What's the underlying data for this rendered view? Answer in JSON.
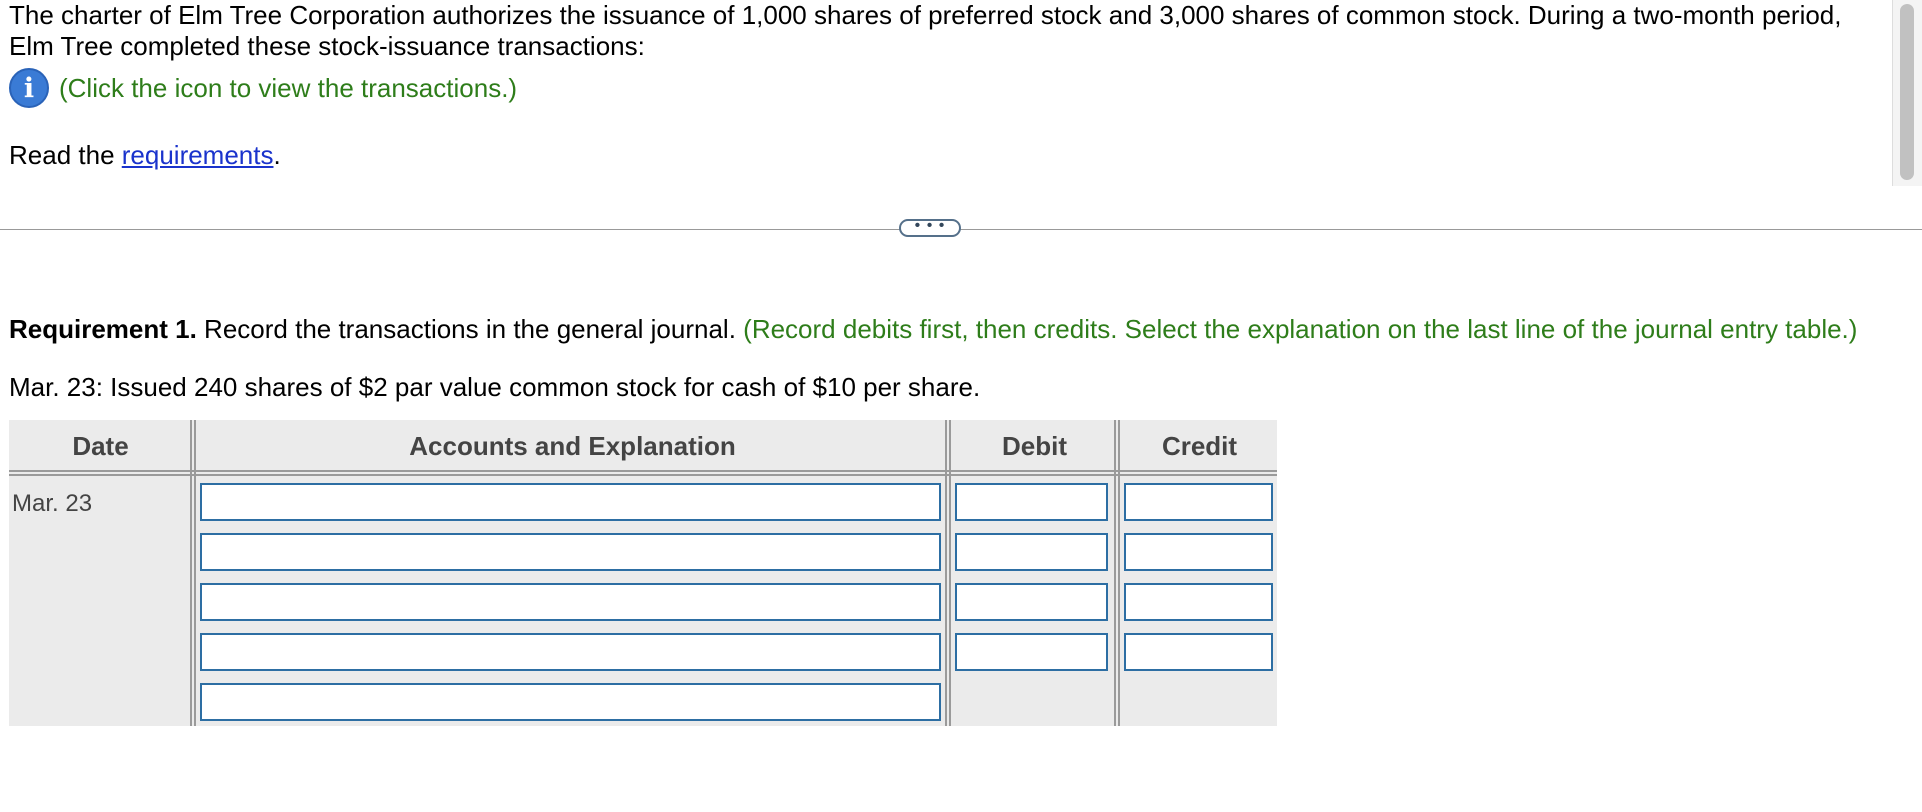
{
  "intro": {
    "text": "The charter of Elm Tree Corporation authorizes the issuance of 1,000 shares of preferred stock and 3,000 shares of common stock. During a two-month period, Elm Tree completed these stock-issuance transactions:",
    "info_icon_glyph": "i",
    "info_link": "(Click the icon to view the transactions.)"
  },
  "read": {
    "prefix": "Read the ",
    "link": "requirements",
    "suffix": "."
  },
  "expander": {
    "label": "• • •"
  },
  "requirement": {
    "bold": "Requirement 1.",
    "text": " Record the transactions in the general journal. ",
    "hint": "(Record debits first, then credits. Select the explanation on the last line of the journal entry table.)"
  },
  "transaction": "Mar. 23: Issued 240 shares of $2 par value common stock for cash of $10 per share.",
  "journal": {
    "headers": {
      "date": "Date",
      "accounts": "Accounts and Explanation",
      "debit": "Debit",
      "credit": "Credit"
    },
    "date_value": "Mar. 23",
    "rows": [
      {
        "account": "",
        "debit": "",
        "credit": ""
      },
      {
        "account": "",
        "debit": "",
        "credit": ""
      },
      {
        "account": "",
        "debit": "",
        "credit": ""
      },
      {
        "account": "",
        "debit": "",
        "credit": ""
      },
      {
        "account": ""
      }
    ]
  },
  "colors": {
    "accent_green": "#2e7d1a",
    "link_blue": "#1a33cc",
    "input_border": "#2d6ea3",
    "table_bg": "#ebebeb"
  }
}
